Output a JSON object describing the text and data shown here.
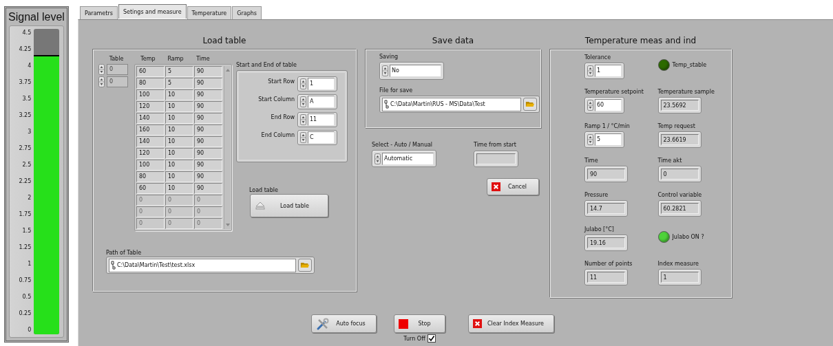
{
  "meter": {
    "title": "Signal level",
    "ticks": [
      "4.5",
      "4.25",
      "4",
      "3.75",
      "3.5",
      "3.25",
      "3",
      "2.75",
      "2.5",
      "2.25",
      "2",
      "1.75",
      "1.5",
      "1.25",
      "1",
      "0.75",
      "0.5",
      "0.25",
      "0"
    ],
    "level": 0.91
  },
  "tabs": [
    {
      "label": "Parametrs",
      "selected": false
    },
    {
      "label": "Setings and measure",
      "selected": true
    },
    {
      "label": "Temperature",
      "selected": false
    },
    {
      "label": "Graphs",
      "selected": false
    }
  ],
  "load_table": {
    "title": "Load table",
    "index_label": "Table",
    "indices": [
      "0",
      "0"
    ],
    "columns": [
      "Temp",
      "Ramp",
      "Time"
    ],
    "rows": [
      {
        "cells": [
          "60",
          "5",
          "90"
        ],
        "disabled": false
      },
      {
        "cells": [
          "80",
          "5",
          "90"
        ],
        "disabled": false
      },
      {
        "cells": [
          "100",
          "10",
          "90"
        ],
        "disabled": false
      },
      {
        "cells": [
          "120",
          "10",
          "90"
        ],
        "disabled": false
      },
      {
        "cells": [
          "140",
          "10",
          "90"
        ],
        "disabled": false
      },
      {
        "cells": [
          "160",
          "10",
          "90"
        ],
        "disabled": false
      },
      {
        "cells": [
          "140",
          "10",
          "90"
        ],
        "disabled": false
      },
      {
        "cells": [
          "120",
          "10",
          "90"
        ],
        "disabled": false
      },
      {
        "cells": [
          "100",
          "10",
          "90"
        ],
        "disabled": false
      },
      {
        "cells": [
          "80",
          "10",
          "90"
        ],
        "disabled": false
      },
      {
        "cells": [
          "60",
          "10",
          "90"
        ],
        "disabled": false
      },
      {
        "cells": [
          "0",
          "0",
          "0"
        ],
        "disabled": true
      },
      {
        "cells": [
          "0",
          "0",
          "0"
        ],
        "disabled": true
      },
      {
        "cells": [
          "0",
          "0",
          "0"
        ],
        "disabled": true
      }
    ],
    "range_title": "Start and End of table",
    "range": [
      {
        "label": "Start Row",
        "value": "1"
      },
      {
        "label": "Start Column",
        "value": "A"
      },
      {
        "label": "End Row",
        "value": "11"
      },
      {
        "label": "End Column",
        "value": "C"
      }
    ],
    "load_label": "Load table",
    "load_button": "Load table",
    "path_label": "Path of Table",
    "path": "C:\\Data\\Martin\\Test\\test.xlsx"
  },
  "save_data": {
    "title": "Save data",
    "saving_label": "Saving",
    "saving": "No",
    "file_label": "File for save",
    "file": "C:\\Data\\Martin\\RUS - MS\\Data\\Test"
  },
  "mode": {
    "label": "Select - Auto / Manual",
    "value": "Automatic"
  },
  "time_from_start": {
    "label": "Time from start"
  },
  "cancel_button": "Cancel",
  "temperature": {
    "title": "Temperature meas and ind",
    "rows": [
      [
        {
          "kind": "control",
          "label": "Tolerance",
          "value": "1"
        },
        {
          "kind": "led",
          "label": "Temp_stable",
          "on": false
        }
      ],
      [
        {
          "kind": "control",
          "label": "Temperature setpoint",
          "value": "60"
        },
        {
          "kind": "indicator",
          "label": "Temperature sample",
          "value": "23.5692"
        }
      ],
      [
        {
          "kind": "control",
          "label": "Ramp 1 / °C/min",
          "value": "5"
        },
        {
          "kind": "indicator",
          "label": "Temp request",
          "value": "23.6619"
        }
      ],
      [
        {
          "kind": "indicator",
          "label": "Time",
          "value": "90"
        },
        {
          "kind": "indicator",
          "label": "Time akt",
          "value": "0"
        }
      ],
      [
        {
          "kind": "indicator",
          "label": "Pressure",
          "value": "14.7"
        },
        {
          "kind": "indicator",
          "label": "Control variable",
          "value": "60.2821"
        }
      ],
      [
        {
          "kind": "indicator",
          "label": "Julabo [°C]",
          "value": "19.16"
        },
        {
          "kind": "led",
          "label": "Julabo ON ?",
          "on": true
        }
      ],
      [
        {
          "kind": "indicator",
          "label": "Number of points",
          "value": "11"
        },
        {
          "kind": "indicator",
          "label": "Index measure",
          "value": "1"
        }
      ]
    ]
  },
  "bottom_buttons": [
    {
      "kind": "tools",
      "label": "Auto focus"
    },
    {
      "kind": "stop",
      "label": "Stop"
    },
    {
      "kind": "clear",
      "label": "Clear Index Measure"
    }
  ],
  "turn_off": {
    "label": "Turn Off",
    "checked": true
  }
}
